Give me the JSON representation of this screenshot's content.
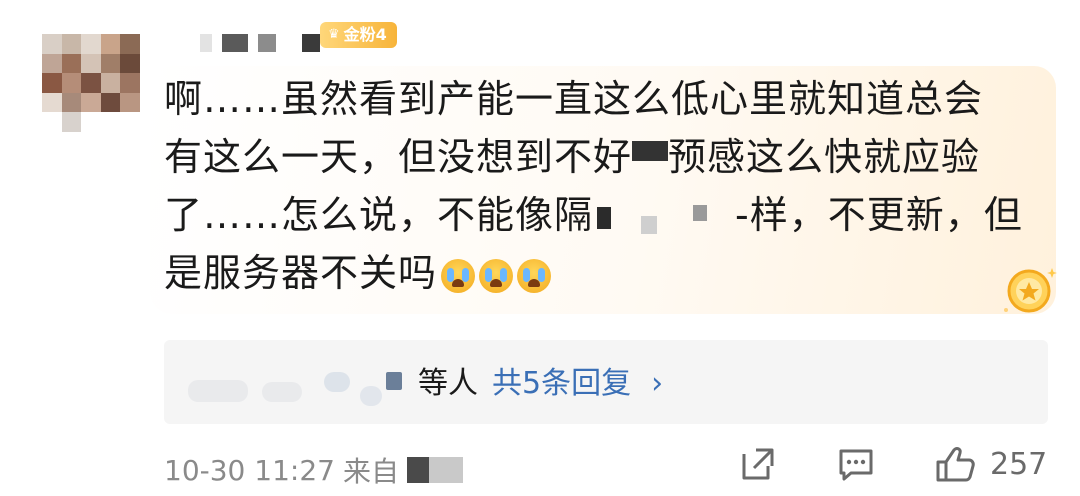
{
  "badge": {
    "label": "金粉4"
  },
  "comment": {
    "line1": "啊……虽然看到产能一直这么低心里就知道总会",
    "line2_a": "有这么一天，但没想到不好",
    "line2_b": "预感这么快就应验",
    "line3_a": "了……怎么说，不能像隔",
    "line3_b": "-样，不更新，但",
    "line4": "是服务器不关吗"
  },
  "replies": {
    "suffix": "等人",
    "link": "共5条回复"
  },
  "meta": {
    "timestamp": "10-30 11:27",
    "source_prefix": "来自"
  },
  "actions": {
    "like_count": "257"
  },
  "colors": {
    "link": "#3a6fb6",
    "meta": "#8a8a8a",
    "badge": "#f7b43a"
  }
}
